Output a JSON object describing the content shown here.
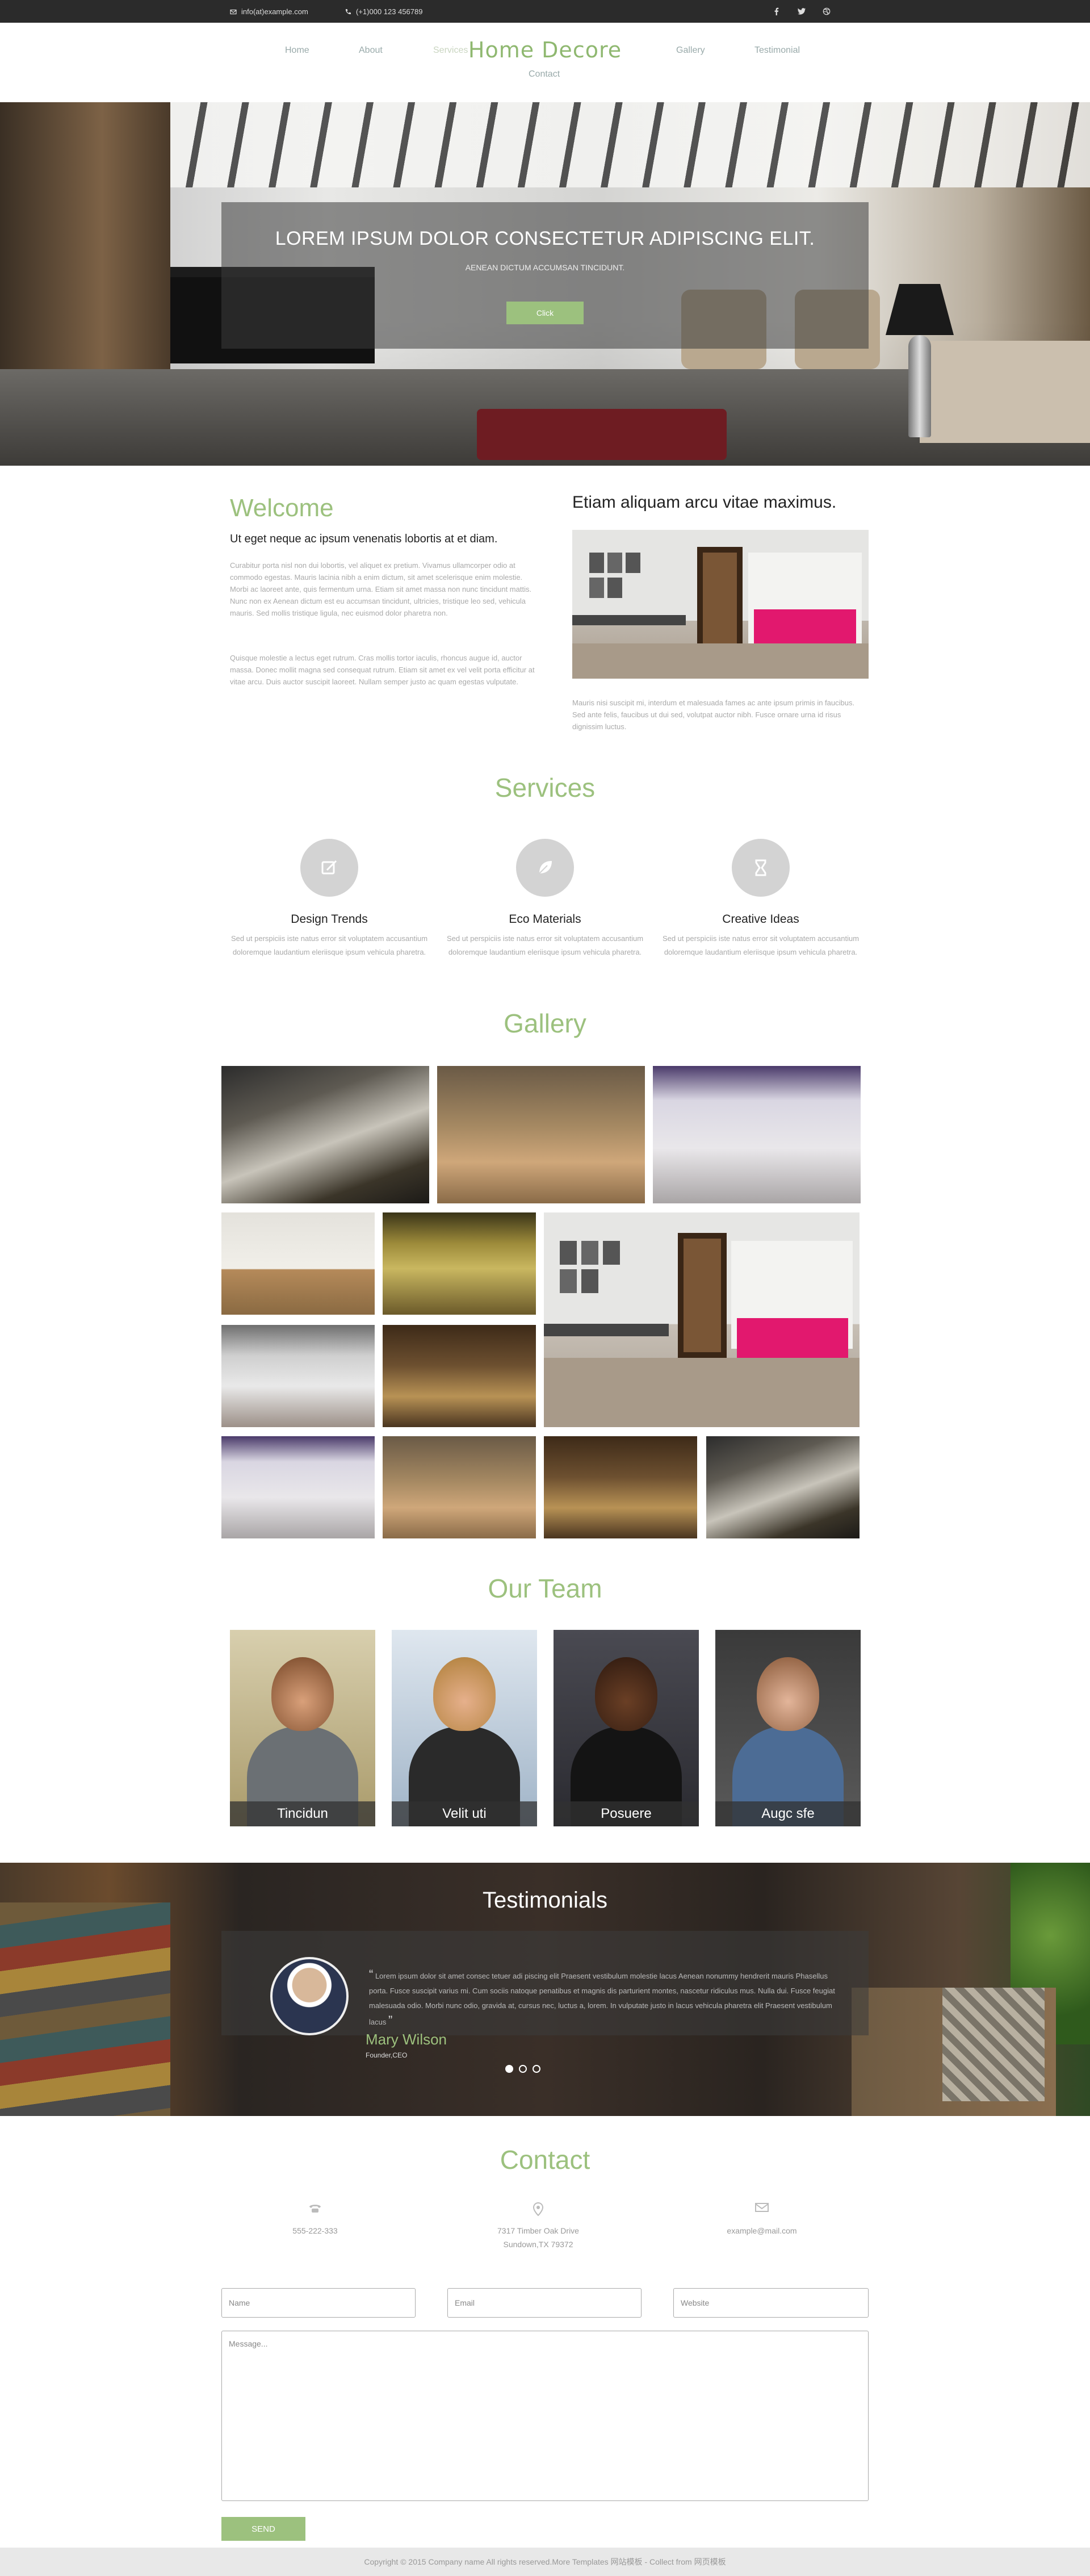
{
  "topbar": {
    "email": "info(at)example.com",
    "phone": "(+1)000 123 456789",
    "social": [
      "facebook-icon",
      "twitter-icon",
      "dribbble-icon"
    ]
  },
  "header": {
    "logo": "Home Decore",
    "nav": [
      "Home",
      "About",
      "Services",
      "Gallery",
      "Testimonial",
      "Contact"
    ]
  },
  "hero": {
    "title": "LOREM IPSUM DOLOR CONSECTETUR ADIPISCING ELIT.",
    "subtitle": "AENEAN DICTUM ACCUMSAN TINCIDUNT.",
    "button": "Click"
  },
  "welcome": {
    "title": "Welcome",
    "subtitle": "Ut eget neque ac ipsum venenatis lobortis at et diam.",
    "para1": "Curabitur porta nisl non dui lobortis, vel aliquet ex pretium. Vivamus ullamcorper odio at commodo egestas. Mauris lacinia nibh a enim dictum, sit amet scelerisque enim molestie. Morbi ac laoreet ante, quis fermentum urna. Etiam sit amet massa non nunc tincidunt mattis. Nunc non ex Aenean dictum est eu accumsan tincidunt, ultricies, tristique leo sed, vehicula mauris. Sed mollis tristique ligula, nec euismod dolor pharetra non.",
    "para2": "Quisque molestie a lectus eget rutrum. Cras mollis tortor iaculis, rhoncus augue id, auctor massa. Donec mollit magna sed consequat rutrum. Etiam sit amet ex vel velit porta efficitur at vitae arcu. Duis auctor suscipit laoreet. Nullam semper justo ac quam egestas vulputate."
  },
  "etiam": {
    "title": "Etiam aliquam arcu vitae maximus.",
    "text": "Mauris nisi suscipit mi, interdum et malesuada fames ac ante ipsum primis in faucibus. Sed ante felis, faucibus ut dui sed, volutpat auctor nibh. Fusce ornare urna id risus dignissim luctus."
  },
  "services": {
    "title": "Services",
    "items": [
      {
        "title": "Design Trends",
        "icon": "edit-icon",
        "text": "Sed ut perspiciis iste natus error sit voluptatem accusantium doloremque laudantium eleriisque ipsum vehicula pharetra."
      },
      {
        "title": "Eco Materials",
        "icon": "leaf-icon",
        "text": "Sed ut perspiciis iste natus error sit voluptatem accusantium doloremque laudantium eleriisque ipsum vehicula pharetra."
      },
      {
        "title": "Creative Ideas",
        "icon": "hourglass-icon",
        "text": "Sed ut perspiciis iste natus error sit voluptatem accusantium doloremque laudantium eleriisque ipsum vehicula pharetra."
      }
    ]
  },
  "gallery": {
    "title": "Gallery"
  },
  "team": {
    "title": "Our Team",
    "members": [
      "Tincidun",
      "Velit uti",
      "Posuere",
      "Augc sfe"
    ]
  },
  "testimonials": {
    "title": "Testimonials",
    "quote": "Lorem ipsum dolor sit amet consec tetuer adi piscing elit Praesent vestibulum molestie lacus Aenean nonummy hendrerit mauris Phasellus porta. Fusce suscipit varius mi. Cum sociis natoque penatibus et magnis dis parturient montes, nascetur ridiculus mus. Nulla dui. Fusce feugiat malesuada odio. Morbi nunc odio, gravida at, cursus nec, luctus a, lorem. In vulputate justo in lacus vehicula pharetra elit Praesent vestibulum lacus",
    "name": "Mary Wilson",
    "role": "Founder,CEO",
    "slides": 3,
    "active_slide": 1
  },
  "contact": {
    "title": "Contact",
    "phone": "555-222-333",
    "address_line1": "7317 Timber Oak Drive",
    "address_line2": "Sundown,TX 79372",
    "email": "example@mail.com",
    "name_placeholder": "Name",
    "email_placeholder": "Email",
    "website_placeholder": "Website",
    "message_placeholder": "Message...",
    "send_label": "SEND"
  },
  "footer": {
    "text": "Copyright © 2015 Company name All rights reserved.More Templates 网站模板 - Collect from 网页模板"
  },
  "colors": {
    "accent": "#9cc17e",
    "topbar": "#2b2b2b"
  }
}
